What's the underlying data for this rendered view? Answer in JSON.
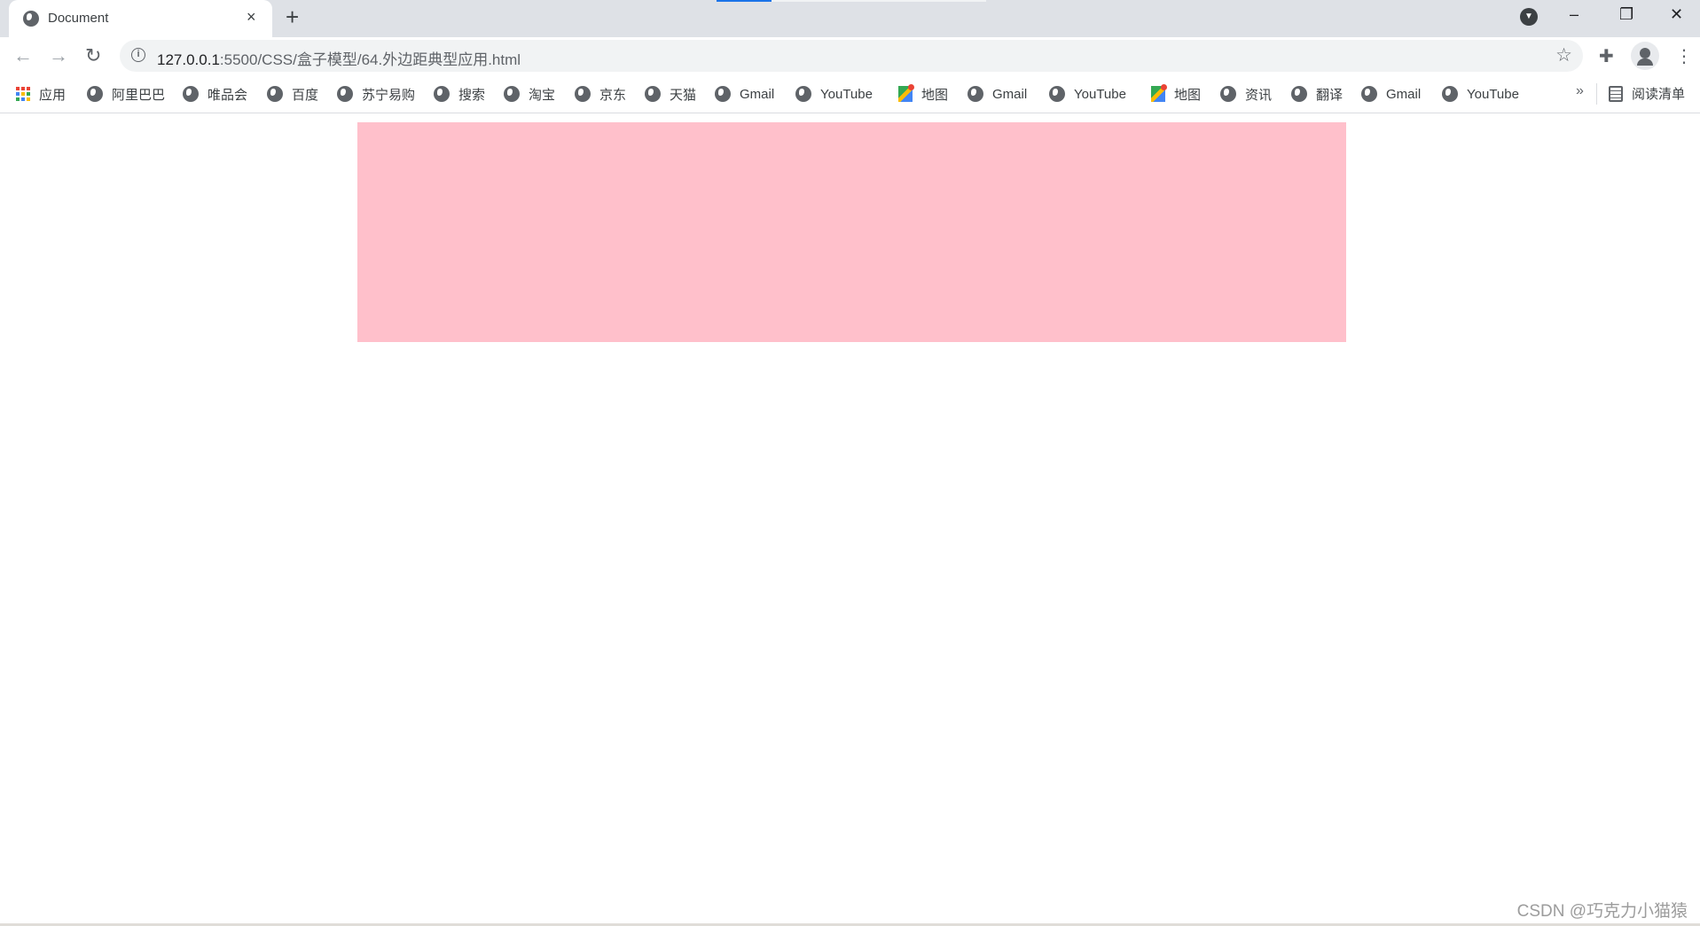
{
  "browser": {
    "tab": {
      "title": "Document",
      "favicon": "globe-icon",
      "close": "×"
    },
    "new_tab": "+",
    "window_controls": {
      "minimize": "–",
      "restore": "❐",
      "close": "✕"
    },
    "address": {
      "host": "127.0.0.1",
      "rest": ":5500/CSS/盒子模型/64.外边距典型应用.html"
    },
    "bookmarks": [
      {
        "label": "应用",
        "icon": "apps-icon"
      },
      {
        "label": "阿里巴巴",
        "icon": "globe-icon"
      },
      {
        "label": "唯品会",
        "icon": "globe-icon"
      },
      {
        "label": "百度",
        "icon": "globe-icon"
      },
      {
        "label": "苏宁易购",
        "icon": "globe-icon"
      },
      {
        "label": "搜索",
        "icon": "globe-icon"
      },
      {
        "label": "淘宝",
        "icon": "globe-icon"
      },
      {
        "label": "京东",
        "icon": "globe-icon"
      },
      {
        "label": "天猫",
        "icon": "globe-icon"
      },
      {
        "label": "Gmail",
        "icon": "globe-icon"
      },
      {
        "label": "YouTube",
        "icon": "globe-icon"
      },
      {
        "label": "地图",
        "icon": "maps-icon"
      },
      {
        "label": "Gmail",
        "icon": "globe-icon"
      },
      {
        "label": "YouTube",
        "icon": "globe-icon"
      },
      {
        "label": "地图",
        "icon": "maps-icon"
      },
      {
        "label": "资讯",
        "icon": "globe-icon"
      },
      {
        "label": "翻译",
        "icon": "globe-icon"
      },
      {
        "label": "Gmail",
        "icon": "globe-icon"
      },
      {
        "label": "YouTube",
        "icon": "globe-icon"
      }
    ],
    "more": "»",
    "reading_list": "阅读清单"
  },
  "page": {
    "box_color": "#ffc0cb"
  },
  "watermark": "CSDN @巧克力小猫猿"
}
